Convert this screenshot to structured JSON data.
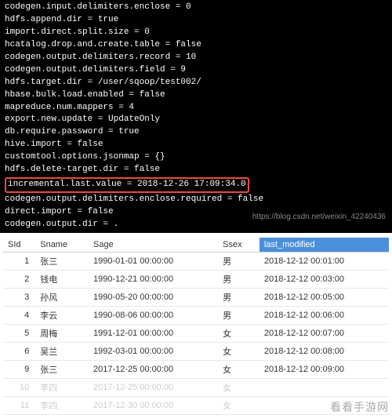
{
  "terminal": {
    "lines": [
      "codegen.input.delimiters.enclose = 0",
      "hdfs.append.dir = true",
      "import.direct.split.size = 0",
      "hcatalog.drop.and.create.table = false",
      "codegen.output.delimiters.record = 10",
      "codegen.output.delimiters.field = 9",
      "hdfs.target.dir = /user/sqoop/test002/",
      "hbase.bulk.load.enabled = false",
      "mapreduce.num.mappers = 4",
      "export.new.update = UpdateOnly",
      "db.require.password = true",
      "hive.import = false",
      "customtool.options.jsonmap = {}",
      "hdfs.delete-target.dir = false"
    ],
    "highlighted_line": "incremental.last.value = 2018-12-26 17:09:34.0",
    "lines_after": [
      "codegen.output.delimiters.enclose.required = false",
      "direct.import = false",
      "codegen.output.dir = ."
    ],
    "watermark": "https://blog.csdn.net/weixin_42240436"
  },
  "table": {
    "headers": {
      "sid": "SId",
      "sname": "Sname",
      "sage": "Sage",
      "ssex": "Ssex",
      "last_modified": "last_modified"
    },
    "rows": [
      {
        "sid": "1",
        "sname": "张三",
        "sage": "1990-01-01 00:00:00",
        "ssex": "男",
        "last_modified": "2018-12-12 00:01:00",
        "faded": false
      },
      {
        "sid": "2",
        "sname": "钱电",
        "sage": "1990-12-21 00:00:00",
        "ssex": "男",
        "last_modified": "2018-12-12 00:03:00",
        "faded": false
      },
      {
        "sid": "3",
        "sname": "孙风",
        "sage": "1990-05-20 00:00:00",
        "ssex": "男",
        "last_modified": "2018-12-12 00:05:00",
        "faded": false
      },
      {
        "sid": "4",
        "sname": "李云",
        "sage": "1990-08-06 00:00:00",
        "ssex": "男",
        "last_modified": "2018-12-12 00:06:00",
        "faded": false
      },
      {
        "sid": "5",
        "sname": "周梅",
        "sage": "1991-12-01 00:00:00",
        "ssex": "女",
        "last_modified": "2018-12-12 00:07:00",
        "faded": false
      },
      {
        "sid": "6",
        "sname": "吴兰",
        "sage": "1992-03-01 00:00:00",
        "ssex": "女",
        "last_modified": "2018-12-12 00:08:00",
        "faded": false
      },
      {
        "sid": "9",
        "sname": "张三",
        "sage": "2017-12-25 00:00:00",
        "ssex": "女",
        "last_modified": "2018-12-12 00:09:00",
        "faded": false
      },
      {
        "sid": "10",
        "sname": "李四",
        "sage": "2017-12-25 00:00:00",
        "ssex": "女",
        "last_modified": "",
        "faded": true
      },
      {
        "sid": "11",
        "sname": "李四",
        "sage": "2017-12-30 00:00:00",
        "ssex": "女",
        "last_modified": "",
        "faded": true
      }
    ],
    "watermark": "看看手游网"
  }
}
